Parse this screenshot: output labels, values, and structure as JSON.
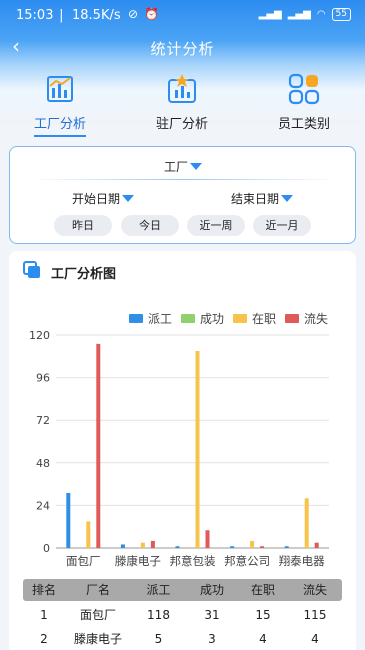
{
  "status_bar": {
    "time": "15:03",
    "network_speed": "18.5K/s",
    "battery": "55"
  },
  "nav": {
    "back_icon": "chevron-left-icon",
    "title": "统计分析"
  },
  "tabs": [
    {
      "label": "工厂分析",
      "icon": "factory-chart-icon",
      "active": true
    },
    {
      "label": "驻厂分析",
      "icon": "resident-chart-icon",
      "active": false
    },
    {
      "label": "员工类别",
      "icon": "category-grid-icon",
      "active": false
    }
  ],
  "filter": {
    "factory_label": "工厂",
    "start_date_label": "开始日期",
    "end_date_label": "结束日期",
    "quick_ranges": [
      "昨日",
      "今日",
      "近一周",
      "近一月"
    ]
  },
  "chart_card": {
    "title": "工厂分析图"
  },
  "colors": {
    "accent": "#2d8cf0",
    "派工": "#2f8fe5",
    "成功": "#8fd16a",
    "在职": "#f7c34a",
    "流失": "#e05a5a"
  },
  "chart_data": {
    "type": "bar",
    "categories": [
      "面包厂",
      "滕康电子",
      "邦意包装",
      "邦意公司",
      "翔泰电器"
    ],
    "series": [
      {
        "name": "派工",
        "values": [
          31,
          2,
          1,
          1,
          1
        ]
      },
      {
        "name": "成功",
        "values": [
          0,
          0,
          0,
          0,
          0
        ]
      },
      {
        "name": "在职",
        "values": [
          15,
          3,
          111,
          4,
          28
        ]
      },
      {
        "name": "流失",
        "values": [
          115,
          4,
          10,
          1,
          3
        ]
      }
    ],
    "yticks": [
      0,
      24,
      48,
      72,
      96,
      120
    ],
    "ylim": [
      0,
      120
    ],
    "grid": true,
    "legend": "top-right"
  },
  "table": {
    "headers": [
      "排名",
      "厂名",
      "派工",
      "成功",
      "在职",
      "流失"
    ],
    "rows": [
      [
        "1",
        "面包厂",
        "118",
        "31",
        "15",
        "115"
      ],
      [
        "2",
        "滕康电子",
        "5",
        "3",
        "4",
        "4"
      ]
    ]
  }
}
